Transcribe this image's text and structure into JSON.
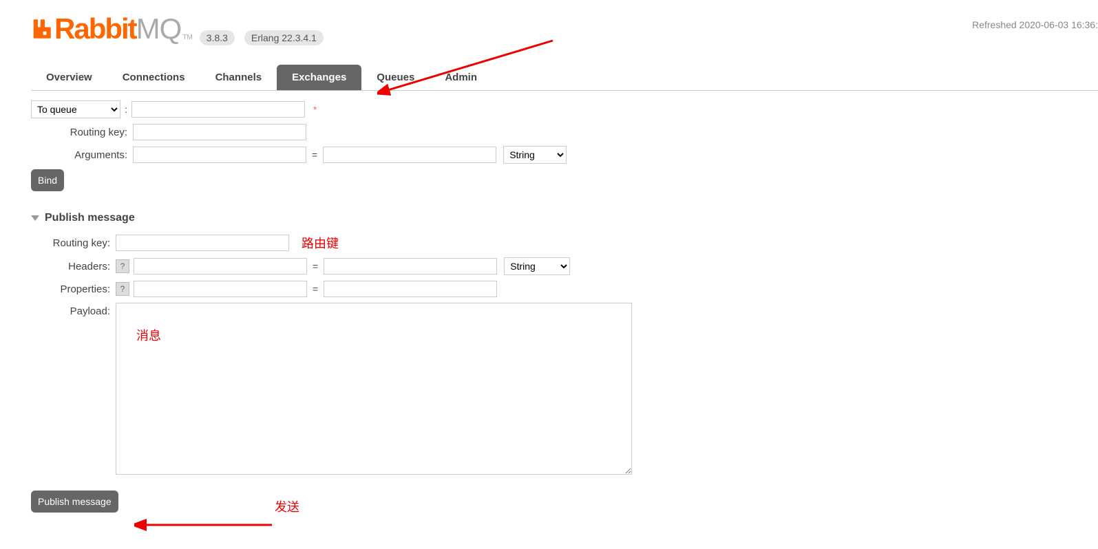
{
  "refreshed": "Refreshed 2020-06-03 16:36:",
  "logo": {
    "rabbit": "Rabbit",
    "mq": "MQ",
    "tm": "TM"
  },
  "version_pill": "3.8.3",
  "erlang_pill": "Erlang 22.3.4.1",
  "tabs": {
    "overview": "Overview",
    "connections": "Connections",
    "channels": "Channels",
    "exchanges": "Exchanges",
    "queues": "Queues",
    "admin": "Admin"
  },
  "bind": {
    "dest_option": "To queue",
    "colon": ":",
    "routing_key_label": "Routing key:",
    "arguments_label": "Arguments:",
    "eq": "=",
    "type_option": "String",
    "button": "Bind",
    "asterisk": "*"
  },
  "publish": {
    "section_title": "Publish message",
    "routing_key_label": "Routing key:",
    "headers_label": "Headers:",
    "properties_label": "Properties:",
    "payload_label": "Payload:",
    "help": "?",
    "eq": "=",
    "type_option": "String",
    "button": "Publish message"
  },
  "annotations": {
    "routing_key": "路由键",
    "payload": "消息",
    "send": "发送"
  }
}
